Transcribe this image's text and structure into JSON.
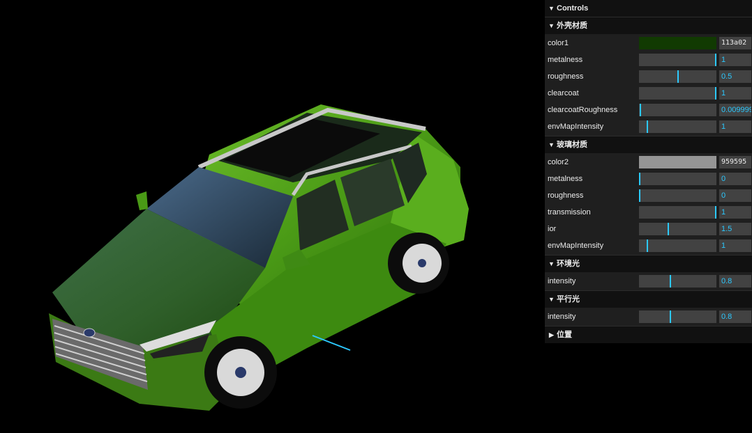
{
  "gui": {
    "title": "Controls",
    "folders": [
      {
        "title": "外壳材质",
        "color": {
          "label": "color1",
          "hex": "113a02",
          "value": "#113a02"
        },
        "sliders": [
          {
            "label": "metalness",
            "value": "1",
            "fraction": 1.0
          },
          {
            "label": "roughness",
            "value": "0.5",
            "fraction": 0.5
          },
          {
            "label": "clearcoat",
            "value": "1",
            "fraction": 1.0
          },
          {
            "label": "clearcoatRoughness",
            "value": "0.009999",
            "fraction": 0.01
          },
          {
            "label": "envMapIntensity",
            "value": "1",
            "fraction": 0.1
          }
        ]
      },
      {
        "title": "玻璃材质",
        "color": {
          "label": "color2",
          "hex": "959595",
          "value": "#959595"
        },
        "sliders": [
          {
            "label": "metalness",
            "value": "0",
            "fraction": 0.0
          },
          {
            "label": "roughness",
            "value": "0",
            "fraction": 0.0
          },
          {
            "label": "transmission",
            "value": "1",
            "fraction": 1.0
          },
          {
            "label": "ior",
            "value": "1.5",
            "fraction": 0.38
          },
          {
            "label": "envMapIntensity",
            "value": "1",
            "fraction": 0.1
          }
        ]
      },
      {
        "title": "环境光",
        "sliders": [
          {
            "label": "intensity",
            "value": "0.8",
            "fraction": 0.4
          }
        ]
      },
      {
        "title": "平行光",
        "sliders": [
          {
            "label": "intensity",
            "value": "0.8",
            "fraction": 0.4
          }
        ]
      },
      {
        "title": "位置",
        "collapsed": true
      }
    ]
  },
  "colors": {
    "accent": "#2cc9ff",
    "panel_bg": "#1f1f1f",
    "title_bg": "#111111",
    "widget_bg": "#424242",
    "car_body": "#4f9a1e"
  }
}
